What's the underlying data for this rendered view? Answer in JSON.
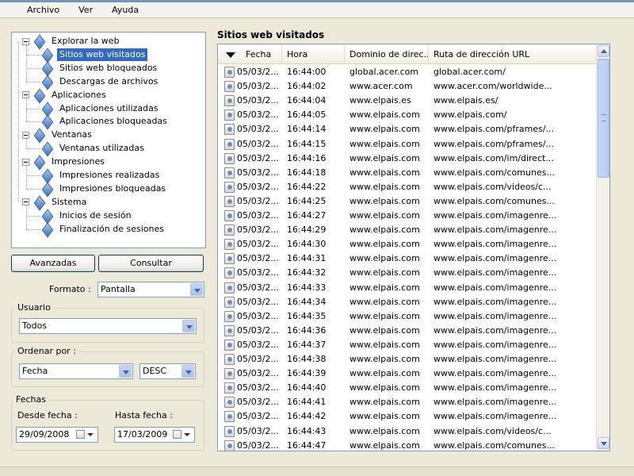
{
  "menu": [
    "Archivo",
    "Ver",
    "Ayuda"
  ],
  "tree": [
    {
      "label": "Explorar la web",
      "level": 0,
      "selected": false
    },
    {
      "label": "Sitios web visitados",
      "level": 1,
      "selected": true
    },
    {
      "label": "Sitios web bloqueados",
      "level": 1,
      "selected": false
    },
    {
      "label": "Descargas de archivos",
      "level": 1,
      "selected": false
    },
    {
      "label": "Aplicaciones",
      "level": 0,
      "selected": false
    },
    {
      "label": "Aplicaciones utilizadas",
      "level": 1,
      "selected": false
    },
    {
      "label": "Aplicaciones bloqueadas",
      "level": 1,
      "selected": false
    },
    {
      "label": "Ventanas",
      "level": 0,
      "selected": false
    },
    {
      "label": "Ventanas utilizadas",
      "level": 1,
      "selected": false
    },
    {
      "label": "Impresiones",
      "level": 0,
      "selected": false
    },
    {
      "label": "Impresiones realizadas",
      "level": 1,
      "selected": false
    },
    {
      "label": "Impresiones bloqueadas",
      "level": 1,
      "selected": false
    },
    {
      "label": "Sistema",
      "level": 0,
      "selected": false
    },
    {
      "label": "Inicios de sesión",
      "level": 1,
      "selected": false
    },
    {
      "label": "Finalización de sesiones",
      "level": 1,
      "selected": false
    }
  ],
  "buttons": {
    "advanced": "Avanzadas",
    "query": "Consultar"
  },
  "format": {
    "label": "Formato :",
    "value": "Pantalla"
  },
  "user": {
    "label": "Usuario",
    "value": "Todos"
  },
  "order": {
    "label": "Ordenar por :",
    "field": "Fecha",
    "direction": "DESC"
  },
  "dates": {
    "label": "Fechas",
    "from_label": "Desde fecha :",
    "from": "29/09/2008",
    "to_label": "Hasta fecha :",
    "to": "17/03/2009"
  },
  "list": {
    "title": "Sitios web visitados",
    "columns": [
      "Fecha",
      "Hora",
      "Dominio de direc...",
      "Ruta de dirección URL"
    ],
    "rows": [
      [
        "05/03/2...",
        "16:44:00",
        "global.acer.com",
        "global.acer.com/"
      ],
      [
        "05/03/2...",
        "16:44:02",
        "www.acer.com",
        "www.acer.com/worldwide..."
      ],
      [
        "05/03/2...",
        "16:44:04",
        "www.elpais.es",
        "www.elpais.es/"
      ],
      [
        "05/03/2...",
        "16:44:05",
        "www.elpais.com",
        "www.elpais.com/"
      ],
      [
        "05/03/2...",
        "16:44:14",
        "www.elpais.com",
        "www.elpais.com/pframes/..."
      ],
      [
        "05/03/2...",
        "16:44:15",
        "www.elpais.com",
        "www.elpais.com/pframes/..."
      ],
      [
        "05/03/2...",
        "16:44:16",
        "www.elpais.com",
        "www.elpais.com/im/direct..."
      ],
      [
        "05/03/2...",
        "16:44:18",
        "www.elpais.com",
        "www.elpais.com/comunes..."
      ],
      [
        "05/03/2...",
        "16:44:22",
        "www.elpais.com",
        "www.elpais.com/videos/c..."
      ],
      [
        "05/03/2...",
        "16:44:25",
        "www.elpais.com",
        "www.elpais.com/comunes..."
      ],
      [
        "05/03/2...",
        "16:44:27",
        "www.elpais.com",
        "www.elpais.com/imagenre..."
      ],
      [
        "05/03/2...",
        "16:44:29",
        "www.elpais.com",
        "www.elpais.com/imagenre..."
      ],
      [
        "05/03/2...",
        "16:44:30",
        "www.elpais.com",
        "www.elpais.com/imagenre..."
      ],
      [
        "05/03/2...",
        "16:44:31",
        "www.elpais.com",
        "www.elpais.com/imagenre..."
      ],
      [
        "05/03/2...",
        "16:44:32",
        "www.elpais.com",
        "www.elpais.com/imagenre..."
      ],
      [
        "05/03/2...",
        "16:44:33",
        "www.elpais.com",
        "www.elpais.com/imagenre..."
      ],
      [
        "05/03/2...",
        "16:44:34",
        "www.elpais.com",
        "www.elpais.com/imagenre..."
      ],
      [
        "05/03/2...",
        "16:44:35",
        "www.elpais.com",
        "www.elpais.com/imagenre..."
      ],
      [
        "05/03/2...",
        "16:44:36",
        "www.elpais.com",
        "www.elpais.com/imagenre..."
      ],
      [
        "05/03/2...",
        "16:44:37",
        "www.elpais.com",
        "www.elpais.com/imagenre..."
      ],
      [
        "05/03/2...",
        "16:44:38",
        "www.elpais.com",
        "www.elpais.com/imagenre..."
      ],
      [
        "05/03/2...",
        "16:44:39",
        "www.elpais.com",
        "www.elpais.com/imagenre..."
      ],
      [
        "05/03/2...",
        "16:44:40",
        "www.elpais.com",
        "www.elpais.com/imagenre..."
      ],
      [
        "05/03/2...",
        "16:44:41",
        "www.elpais.com",
        "www.elpais.com/imagenre..."
      ],
      [
        "05/03/2...",
        "16:44:42",
        "www.elpais.com",
        "www.elpais.com/imagenre..."
      ],
      [
        "05/03/2...",
        "16:44:43",
        "www.elpais.com",
        "www.elpais.com/videos/c..."
      ],
      [
        "05/03/2...",
        "16:44:47",
        "www.elpais.com",
        "www.elpais.com/comunes..."
      ]
    ]
  }
}
